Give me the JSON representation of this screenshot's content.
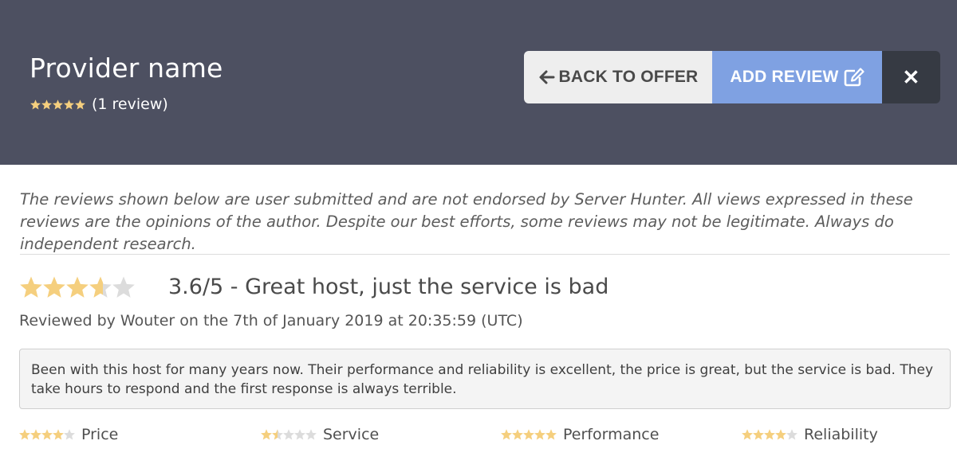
{
  "header": {
    "provider_name": "Provider name",
    "rating": 5,
    "review_count": "(1 review)",
    "back_label": "BACK TO OFFER",
    "add_label": "ADD REVIEW",
    "close_label": "✕"
  },
  "disclaimer": "The reviews shown below are user submitted and are not endorsed by Server Hunter. All views expressed in these reviews are the opinions of the author. Despite our best efforts, some reviews may not be legitimate. Always do independent research.",
  "review": {
    "rating": 3.6,
    "title": "3.6/5 - Great host, just the service is bad",
    "meta": "Reviewed by Wouter on the 7th of January 2019 at 20:35:59 (UTC)",
    "body": "Been with this host for many years now. Their performance and reliability is excellent, the price is great, but the service is bad. They take hours to respond and the first response is always terrible.",
    "sub_ratings": [
      {
        "label": "Price",
        "rating": 4
      },
      {
        "label": "Service",
        "rating": 1.5
      },
      {
        "label": "Performance",
        "rating": 5
      },
      {
        "label": "Reliability",
        "rating": 4
      }
    ]
  },
  "colors": {
    "header_bg": "#4d5061",
    "star_filled": "#f5cf7e",
    "star_empty": "#dcdcdc",
    "add_button": "#7fa1e2",
    "close_button": "#363a43"
  },
  "icons": {
    "back": "arrow-left-icon",
    "add": "edit-icon",
    "close": "close-icon",
    "star": "star-icon"
  }
}
